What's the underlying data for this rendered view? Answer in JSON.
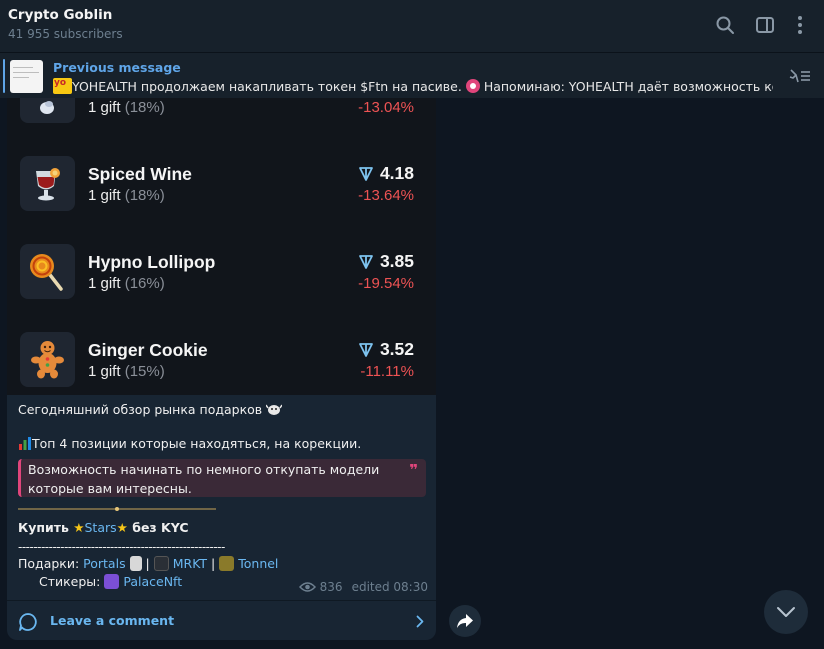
{
  "header": {
    "title": "Crypto Goblin",
    "subscribers": "41 955 subscribers"
  },
  "pinned": {
    "label": "Previous message",
    "text_part1": "YOHEALTH продолжаем накапливать токен $Ftn на пасиве.",
    "text_part2": "Напоминаю: YOHEALTH даёт возможность ко...",
    "badge": "yo"
  },
  "gifts": [
    {
      "name": "",
      "count": "1 gift",
      "percent": "(18%)",
      "price": "",
      "change": "-13.04%",
      "icon": "partial-gift-icon"
    },
    {
      "name": "Spiced Wine",
      "count": "1 gift",
      "percent": "(18%)",
      "price": "4.18",
      "change": "-13.64%",
      "icon": "spiced-wine-icon"
    },
    {
      "name": "Hypno Lollipop",
      "count": "1 gift",
      "percent": "(16%)",
      "price": "3.85",
      "change": "-19.54%",
      "icon": "hypno-lollipop-icon"
    },
    {
      "name": "Ginger Cookie",
      "count": "1 gift",
      "percent": "(15%)",
      "price": "3.52",
      "change": "-11.11%",
      "icon": "ginger-cookie-icon"
    }
  ],
  "message": {
    "line1": "Сегодняшний обзор рынка подарков",
    "line2": "Топ 4 позиции которые находяться, на корекции.",
    "quote_line1": "Возможность начинать по немного откупать модели",
    "quote_line2": "которые вам  интересны.",
    "buy_prefix": "Купить ",
    "buy_link": "Stars",
    "buy_suffix": " без KYC",
    "dashes": "------------------------------------------------------",
    "gifts_label": "Подарки: ",
    "link_portals": "Portals",
    "sep": " | ",
    "link_mrkt": "MRKT",
    "link_tonnel": "Tonnel",
    "stickers_label": "Стикеры: ",
    "link_palace": "PalaceNft",
    "views": "836",
    "edited": "edited 08:30"
  },
  "comment": {
    "label": "Leave a comment"
  },
  "colors": {
    "accent": "#6ab7f0",
    "negative": "#ee5354",
    "quote_border": "#e0457b",
    "ton": "#7ec3ef"
  }
}
